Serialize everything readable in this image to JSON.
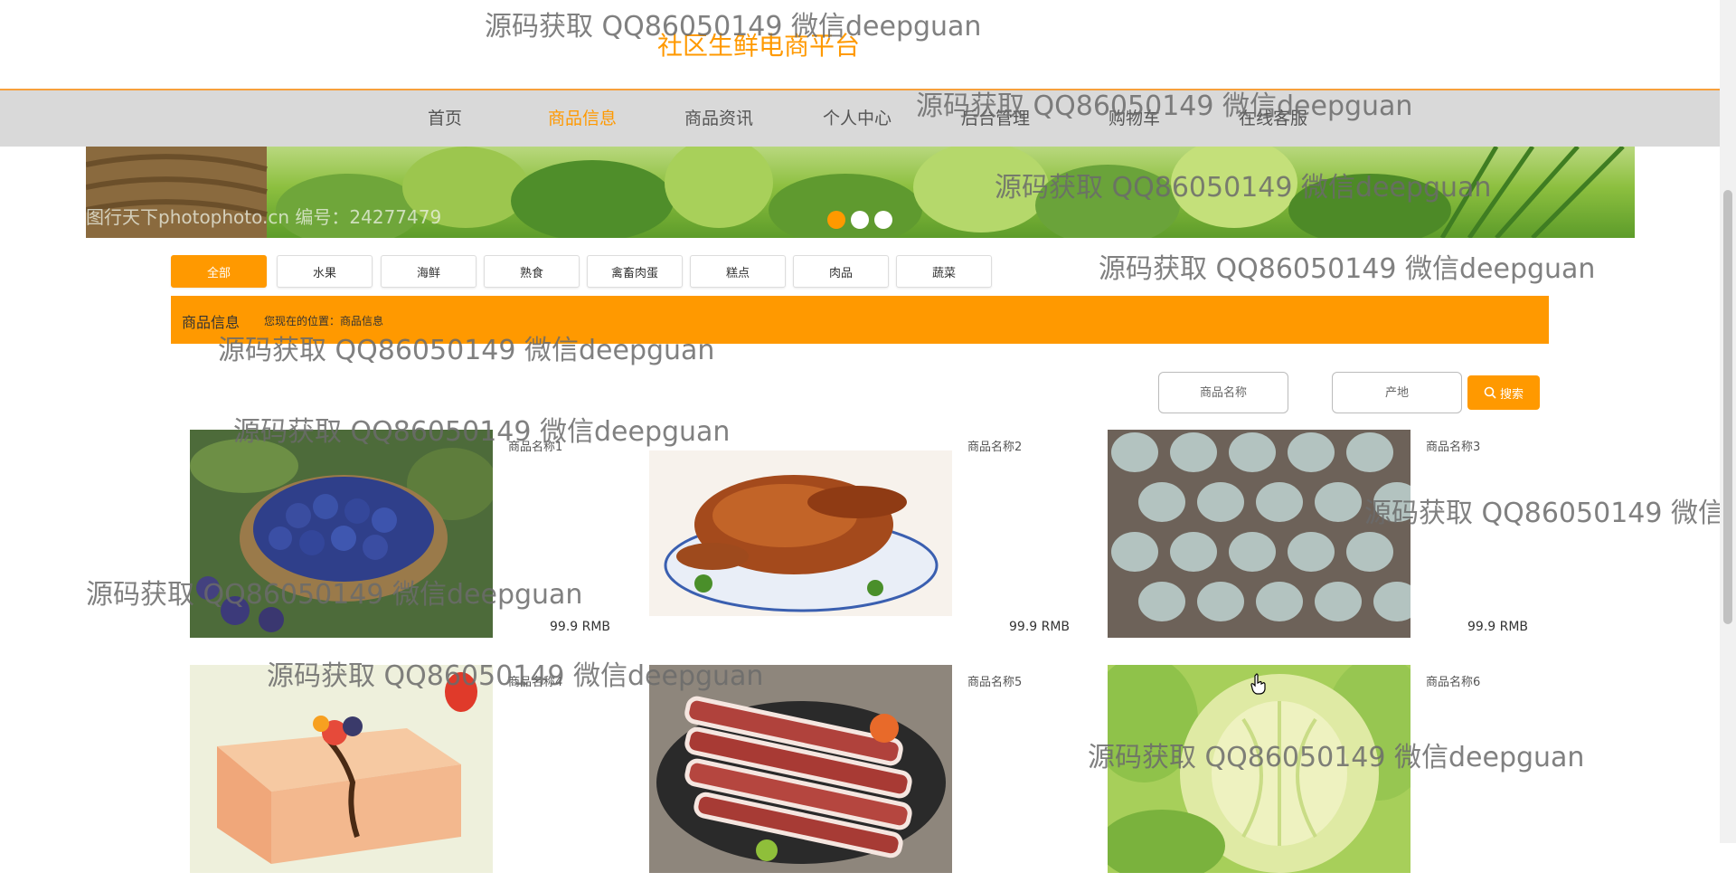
{
  "header": {
    "title": "社区生鲜电商平台"
  },
  "nav": {
    "items": [
      {
        "label": "首页",
        "active": false
      },
      {
        "label": "商品信息",
        "active": true
      },
      {
        "label": "商品资讯",
        "active": false
      },
      {
        "label": "个人中心",
        "active": false
      },
      {
        "label": "后台管理",
        "active": false
      },
      {
        "label": "购物车",
        "active": false
      },
      {
        "label": "在线客服",
        "active": false
      }
    ]
  },
  "banner": {
    "caption": "图行天下photophoto.cn  编号：24277479",
    "dots": 3,
    "active_dot": 0
  },
  "categories": [
    "全部",
    "水果",
    "海鲜",
    "熟食",
    "禽畜肉蛋",
    "糕点",
    "肉品",
    "蔬菜"
  ],
  "breadcrumb": {
    "title": "商品信息",
    "location": "您现在的位置：商品信息"
  },
  "search": {
    "name_placeholder": "商品名称",
    "origin_placeholder": "产地",
    "button_label": "搜索"
  },
  "products": [
    {
      "name": "商品名称1",
      "price": "99.9 RMB",
      "image": "blueberries"
    },
    {
      "name": "商品名称2",
      "price": "99.9 RMB",
      "image": "roast-duck"
    },
    {
      "name": "商品名称3",
      "price": "99.9 RMB",
      "image": "eggs"
    },
    {
      "name": "商品名称4",
      "price": "",
      "image": "cake"
    },
    {
      "name": "商品名称5",
      "price": "",
      "image": "meat-slices"
    },
    {
      "name": "商品名称6",
      "price": "",
      "image": "cabbage"
    }
  ],
  "watermark": "源码获取 QQ86050149 微信deepguan",
  "colors": {
    "accent": "#ff9900",
    "nav_bg": "#d9d9d9"
  }
}
